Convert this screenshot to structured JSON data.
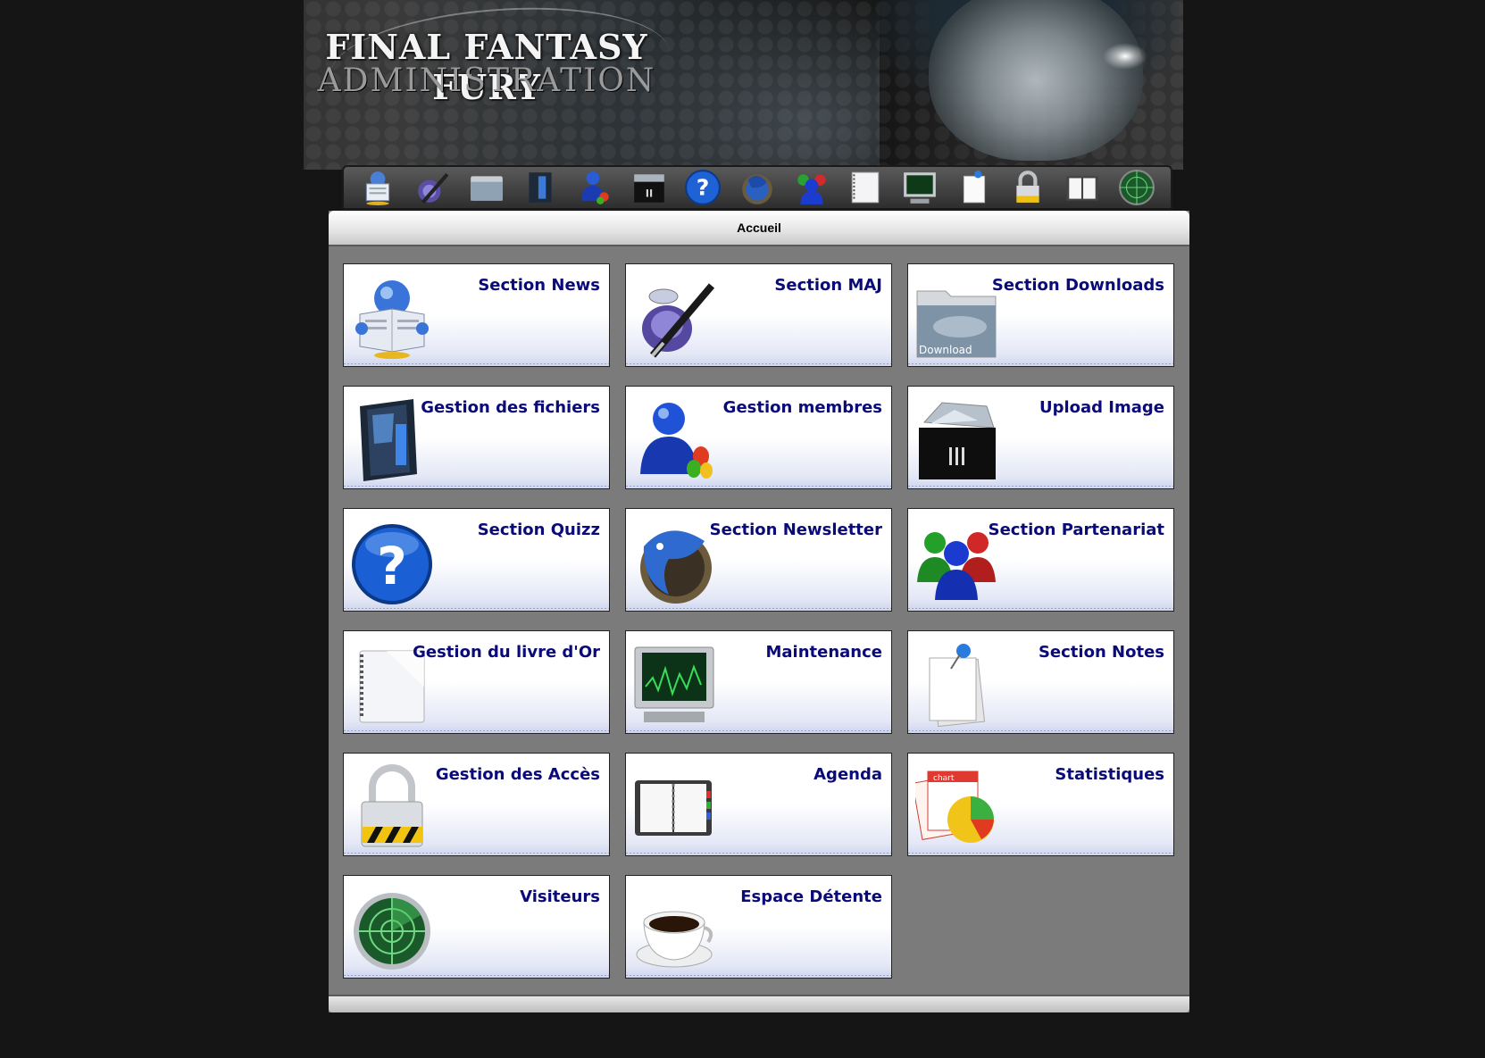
{
  "banner": {
    "title": "FINAL FANTASY FURY",
    "subtitle": "ADMINISTRATION"
  },
  "toolbar": {
    "icons": [
      "news-icon",
      "pen-icon",
      "download-folder-icon",
      "file-folder-icon",
      "members-icon",
      "upload-icon",
      "help-icon",
      "newsletter-icon",
      "partners-icon",
      "notebook-icon",
      "monitor-icon",
      "note-icon",
      "lock-icon",
      "agenda-icon",
      "radar-icon"
    ]
  },
  "panel": {
    "title": "Accueil"
  },
  "cards": [
    {
      "label": "Section News",
      "icon": "news-icon"
    },
    {
      "label": "Section MAJ",
      "icon": "pen-icon"
    },
    {
      "label": "Section Downloads",
      "icon": "download-folder-icon",
      "icon_text": "Download"
    },
    {
      "label": "Gestion des fichiers",
      "icon": "file-folder-icon"
    },
    {
      "label": "Gestion membres",
      "icon": "members-icon"
    },
    {
      "label": "Upload Image",
      "icon": "upload-icon"
    },
    {
      "label": "Section Quizz",
      "icon": "help-icon"
    },
    {
      "label": "Section Newsletter",
      "icon": "newsletter-icon"
    },
    {
      "label": "Section Partenariat",
      "icon": "partners-icon"
    },
    {
      "label": "Gestion du livre d'Or",
      "icon": "notebook-icon"
    },
    {
      "label": "Maintenance",
      "icon": "monitor-icon"
    },
    {
      "label": "Section Notes",
      "icon": "note-icon"
    },
    {
      "label": "Gestion des Accès",
      "icon": "lock-icon"
    },
    {
      "label": "Agenda",
      "icon": "agenda-icon"
    },
    {
      "label": "Statistiques",
      "icon": "chart-icon",
      "icon_text": "chart"
    },
    {
      "label": "Visiteurs",
      "icon": "radar-icon"
    },
    {
      "label": "Espace Détente",
      "icon": "coffee-icon"
    }
  ],
  "colors": {
    "page_bg": "#151515",
    "panel_bg": "#7b7b7b",
    "card_title": "#0a0a78"
  }
}
